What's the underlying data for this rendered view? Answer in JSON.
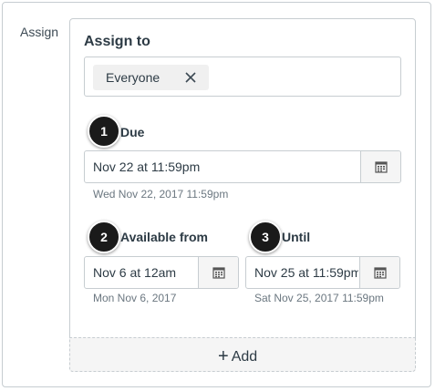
{
  "side_label": "Assign",
  "assign_to": {
    "title": "Assign to",
    "token": "Everyone"
  },
  "due": {
    "step": "1",
    "label": "Due",
    "value": "Nov 22 at 11:59pm",
    "hint": "Wed Nov 22, 2017 11:59pm"
  },
  "available_from": {
    "step": "2",
    "label": "Available from",
    "value": "Nov 6 at 12am",
    "hint": "Mon Nov 6, 2017"
  },
  "until": {
    "step": "3",
    "label": "Until",
    "value": "Nov 25 at 11:59pm",
    "hint": "Sat Nov 25, 2017 11:59pm"
  },
  "add_button": {
    "label": "Add"
  },
  "icons": {
    "remove": "close-icon",
    "calendar": "calendar-icon",
    "add": "plus-icon"
  },
  "colors": {
    "text": "#2d3b45",
    "border": "#c7cdd1",
    "hint": "#6b7780",
    "badge": "#1a1a1a"
  }
}
